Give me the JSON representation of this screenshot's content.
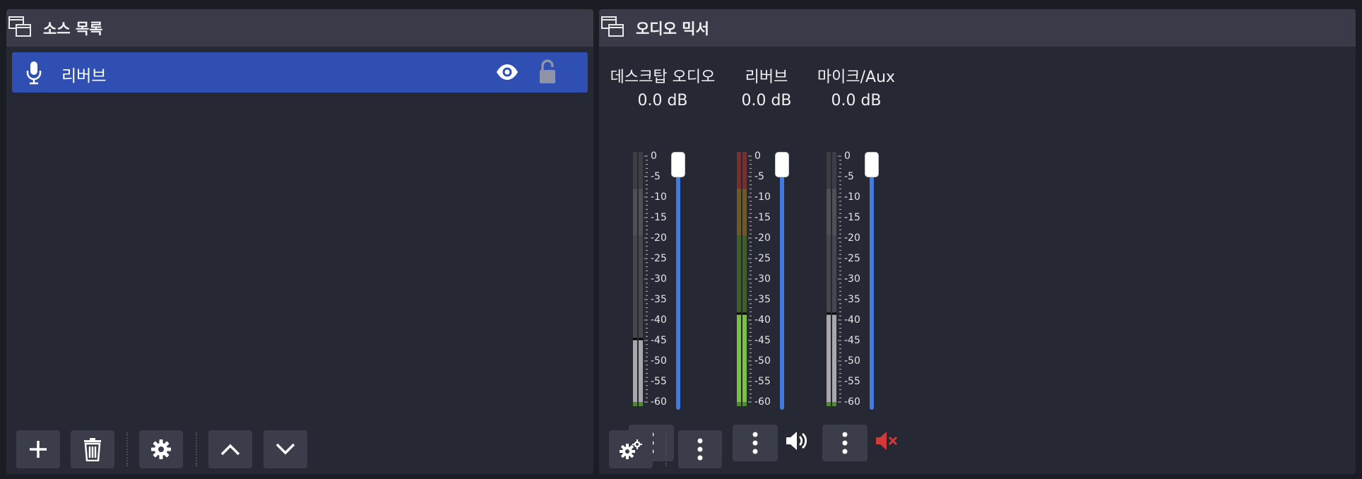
{
  "sources_dock": {
    "title": "소스 목록",
    "items": [
      {
        "label": "리버브",
        "type_icon": "microphone-icon",
        "visible": true,
        "locked": false
      }
    ],
    "toolbar": [
      "plus-icon",
      "trash-icon",
      "gear-icon",
      "chevron-up-icon",
      "chevron-down-icon"
    ]
  },
  "mixer_dock": {
    "title": "오디오 믹서",
    "scale_ticks": [
      "0",
      "-5",
      "-10",
      "-15",
      "-20",
      "-25",
      "-30",
      "-35",
      "-40",
      "-45",
      "-50",
      "-55",
      "-60"
    ],
    "channels": [
      {
        "name": "데스크탑 오디오",
        "db": "0.0 dB",
        "muted": true,
        "meter_level": 0.26,
        "meter_color": "gray"
      },
      {
        "name": "리버브",
        "db": "0.0 dB",
        "muted": false,
        "meter_level": 0.36,
        "meter_color": "green"
      },
      {
        "name": "마이크/Aux",
        "db": "0.0 dB",
        "muted": true,
        "meter_level": 0.36,
        "meter_color": "gray"
      }
    ],
    "toolbar": [
      "advanced-audio-gear-icon",
      "mixer-menu-icon"
    ]
  },
  "colors": {
    "selection": "#2f4fb2",
    "slider": "#3f7be0",
    "muted": "#d23a3a",
    "meter_green": "#7bc043"
  }
}
